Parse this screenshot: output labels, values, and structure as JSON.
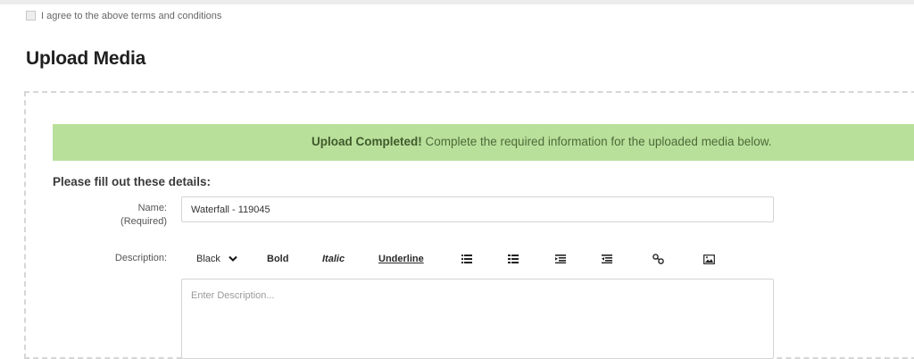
{
  "terms": {
    "label": "I agree to the above terms and conditions"
  },
  "page": {
    "title": "Upload Media"
  },
  "banner": {
    "strong": "Upload Completed!",
    "message": " Complete the required information for the uploaded media below."
  },
  "form": {
    "details_title": "Please fill out these details:",
    "name_label": "Name:",
    "name_required": "(Required)",
    "name_value": "Waterfall - 119045",
    "description_label": "Description:",
    "description_placeholder": "Enter Description..."
  },
  "toolbar": {
    "color_select": "Black",
    "bold": "Bold",
    "italic": "Italic",
    "underline": "Underline",
    "icons": [
      "unordered-list-icon",
      "ordered-list-icon",
      "outdent-icon",
      "indent-icon",
      "link-icon",
      "image-icon"
    ]
  },
  "colors": {
    "banner_bg": "#b9e09b",
    "banner_text": "#4d6a38"
  }
}
